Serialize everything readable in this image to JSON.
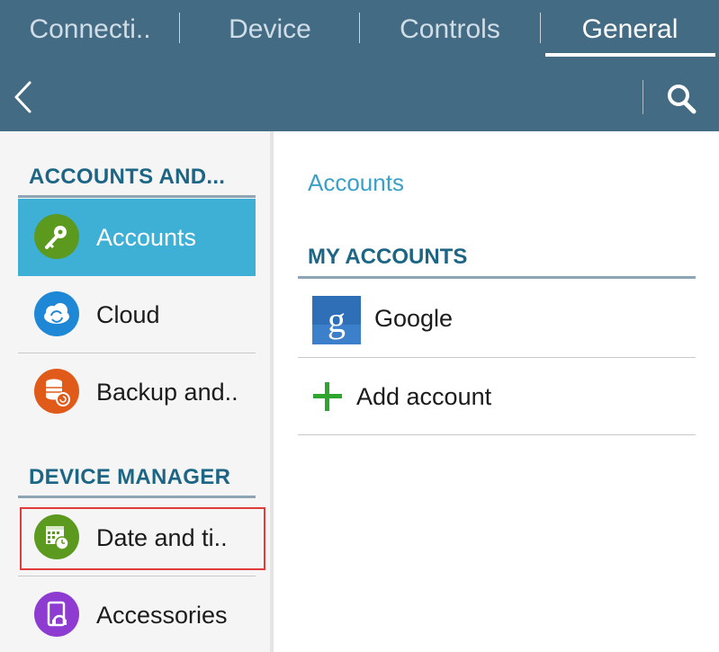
{
  "tabs": [
    {
      "label": "Connecti.."
    },
    {
      "label": "Device"
    },
    {
      "label": "Controls"
    },
    {
      "label": "General",
      "active": true
    }
  ],
  "actionbar": {
    "back_icon": "chevron-left-icon",
    "search_icon": "search-icon"
  },
  "sidebar": {
    "sections": [
      {
        "title": "ACCOUNTS AND...",
        "items": [
          {
            "label": "Accounts",
            "icon": "key-icon",
            "icon_color": "#5b9a1e",
            "selected": true
          },
          {
            "label": "Cloud",
            "icon": "cloud-sync-icon",
            "icon_color": "#1f88d6"
          },
          {
            "label": "Backup and..",
            "icon": "database-backup-icon",
            "icon_color": "#e05a1a"
          }
        ]
      },
      {
        "title": "DEVICE MANAGER",
        "items": [
          {
            "label": "Date and ti..",
            "icon": "calendar-clock-icon",
            "icon_color": "#5b9a1e",
            "focused": true
          },
          {
            "label": "Accessories",
            "icon": "headset-device-icon",
            "icon_color": "#8d3bd0"
          }
        ]
      }
    ]
  },
  "main": {
    "breadcrumb": "Accounts",
    "section_title": "MY ACCOUNTS",
    "accounts": [
      {
        "label": "Google",
        "icon": "google-icon"
      }
    ],
    "add_account_label": "Add account",
    "add_icon": "plus-icon"
  },
  "colors": {
    "header_bg": "#436b84",
    "selected_bg": "#3eb0d6",
    "section_title": "#1c6584",
    "accent_link": "#3aa0c8",
    "add_green": "#2ea52e",
    "focus_outline": "#e03c3c"
  }
}
